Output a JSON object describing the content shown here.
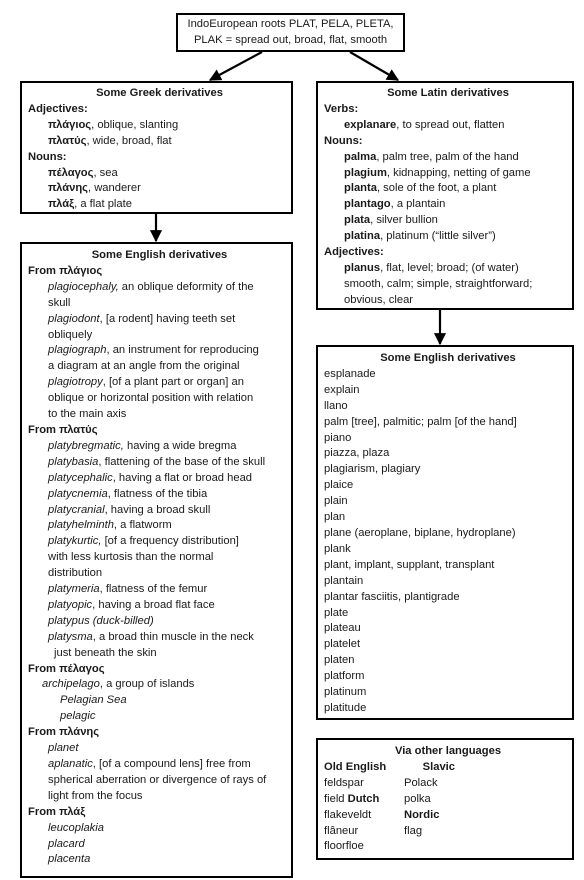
{
  "root": {
    "line1": "IndoEuropean roots PLAT, PELA, PLETA,",
    "line2": "PLAK = spread out, broad, flat, smooth"
  },
  "greek": {
    "title": "Some Greek derivatives",
    "adjectives_label": "Adjectives:",
    "adjectives": [
      {
        "word": "πλάγιος",
        "gloss": ", oblique, slanting"
      },
      {
        "word": "πλατύς",
        "gloss": ", wide, broad, flat"
      }
    ],
    "nouns_label": "Nouns:",
    "nouns": [
      {
        "word": "πέλαγος",
        "gloss": ", sea"
      },
      {
        "word": "πλάνης",
        "gloss": ", wanderer"
      },
      {
        "word": "πλάξ",
        "gloss": ", a flat plate"
      }
    ]
  },
  "latin": {
    "title": "Some Latin derivatives",
    "verbs_label": "Verbs:",
    "verbs": [
      {
        "word": "explanare",
        "gloss": ", to spread out, flatten"
      }
    ],
    "nouns_label": "Nouns:",
    "nouns": [
      {
        "word": "palma",
        "gloss": ", palm tree, palm of the hand"
      },
      {
        "word": "plagium",
        "gloss": ", kidnapping, netting of game"
      },
      {
        "word": "planta",
        "gloss": ", sole of the foot, a plant"
      },
      {
        "word": "plantago",
        "gloss": ", a plantain"
      },
      {
        "word": "plata",
        "gloss": ", silver bullion"
      },
      {
        "word": "platina",
        "gloss": ", platinum (“little silver”)"
      }
    ],
    "adjectives_label": "Adjectives:",
    "adjectives": [
      {
        "word": "planus",
        "gloss": ", flat, level; broad; (of water)"
      }
    ],
    "adjective_cont": [
      "smooth, calm; simple, straightforward;",
      "obvious, clear"
    ]
  },
  "english_from_greek": {
    "title": "Some English derivatives",
    "groups": [
      {
        "heading": "From πλάγιος",
        "entries": [
          {
            "word": " plagiocephaly,",
            "gloss": " an oblique deformity of the",
            "cont": [
              "skull"
            ]
          },
          {
            "word": "plagiodont",
            "gloss": ", [a rodent] having teeth set",
            "cont": [
              "obliquely"
            ]
          },
          {
            "word": "plagiograph",
            "gloss": ", an instrument for reproducing",
            "cont": [
              "a diagram at an angle from the original"
            ]
          },
          {
            "word": "plagiotropy",
            "gloss": ", [of a plant part or organ] an",
            "cont": [
              "oblique or horizontal position with relation",
              "to the main axis"
            ]
          }
        ]
      },
      {
        "heading": "From πλατύς",
        "entries": [
          {
            "word": "platybregmatic,",
            "gloss": " having a wide bregma",
            "cont": []
          },
          {
            "word": "platybasia",
            "gloss": ", flattening of the base of the skull",
            "cont": []
          },
          {
            "word": "platycephalic",
            "gloss": ", having a flat or broad head",
            "cont": []
          },
          {
            "word": "platycnemia",
            "gloss": ", flatness of the tibia",
            "cont": []
          },
          {
            "word": "platycranial",
            "gloss": ", having a broad skull",
            "cont": []
          },
          {
            "word": "platyhelminth",
            "gloss": ", a flatworm",
            "cont": []
          },
          {
            "word": "platykurtic,",
            "gloss": " [of a frequency distribution]",
            "cont": [
              "with less kurtosis than the normal",
              "distribution"
            ]
          },
          {
            "word": "platymeria",
            "gloss": ", flatness of the femur",
            "cont": []
          },
          {
            "word": "platyopic",
            "gloss": ", having a broad flat face",
            "cont": []
          },
          {
            "word": "platypus (duck-billed)",
            "gloss": "",
            "cont": []
          },
          {
            "word": "platysma",
            "gloss": ", a broad thin muscle in the neck",
            "cont": [
              "just beneath the skin"
            ]
          }
        ]
      },
      {
        "heading": "From πέλαγος",
        "entries": [
          {
            "word": "archipelago",
            "gloss": ", a group of islands",
            "cont": []
          },
          {
            "word": "Pelagian Sea",
            "gloss": "",
            "cont": []
          },
          {
            "word": "pelagic",
            "gloss": "",
            "cont": []
          }
        ]
      },
      {
        "heading": "From πλάνης",
        "entries": [
          {
            "word": "planet",
            "gloss": "",
            "cont": []
          },
          {
            "word": "aplanatic",
            "gloss": ", [of a compound lens] free from",
            "cont": [
              "spherical aberration or divergence of rays of",
              "light from the focus"
            ]
          }
        ]
      },
      {
        "heading": "From πλάξ",
        "entries": [
          {
            "word": "leucoplakia",
            "gloss": "",
            "cont": []
          },
          {
            "word": "placard",
            "gloss": "",
            "cont": []
          },
          {
            "word": "placenta",
            "gloss": "",
            "cont": []
          }
        ]
      }
    ]
  },
  "english_from_latin": {
    "title": "Some English derivatives",
    "items": [
      "esplanade",
      "explain",
      "llano",
      "palm [tree], palmitic; palm [of the hand]",
      "piano",
      "piazza, plaza",
      "plagiarism, plagiary",
      "plaice",
      "plain",
      "plan",
      "plane (aeroplane, biplane, hydroplane)",
      "plank",
      "plant, implant, supplant, transplant",
      "plantain",
      "plantar fasciitis, plantigrade",
      "plate",
      "plateau",
      "platelet",
      "platen",
      "platform",
      "platinum",
      "platitude"
    ]
  },
  "via_other": {
    "title": "Via other languages",
    "rows": [
      [
        {
          "t": "Old English",
          "b": true
        },
        {
          "t": "      Slavic",
          "b": true
        }
      ],
      [
        {
          "t": "feldspar",
          "b": false
        },
        {
          "t": "Polack",
          "b": false
        }
      ],
      [
        {
          "t": "field ",
          "b": false,
          "extra": "Dutch"
        },
        {
          "t": "polka",
          "b": false
        }
      ],
      [
        {
          "t": "flakeveldt",
          "b": false
        },
        {
          "t": "Nordic",
          "b": true
        }
      ],
      [
        {
          "t": "flâneur",
          "b": false
        },
        {
          "t": "flag",
          "b": false
        }
      ],
      [
        {
          "t": "floorfloe",
          "b": false
        },
        {
          "t": "",
          "b": false
        }
      ]
    ]
  }
}
